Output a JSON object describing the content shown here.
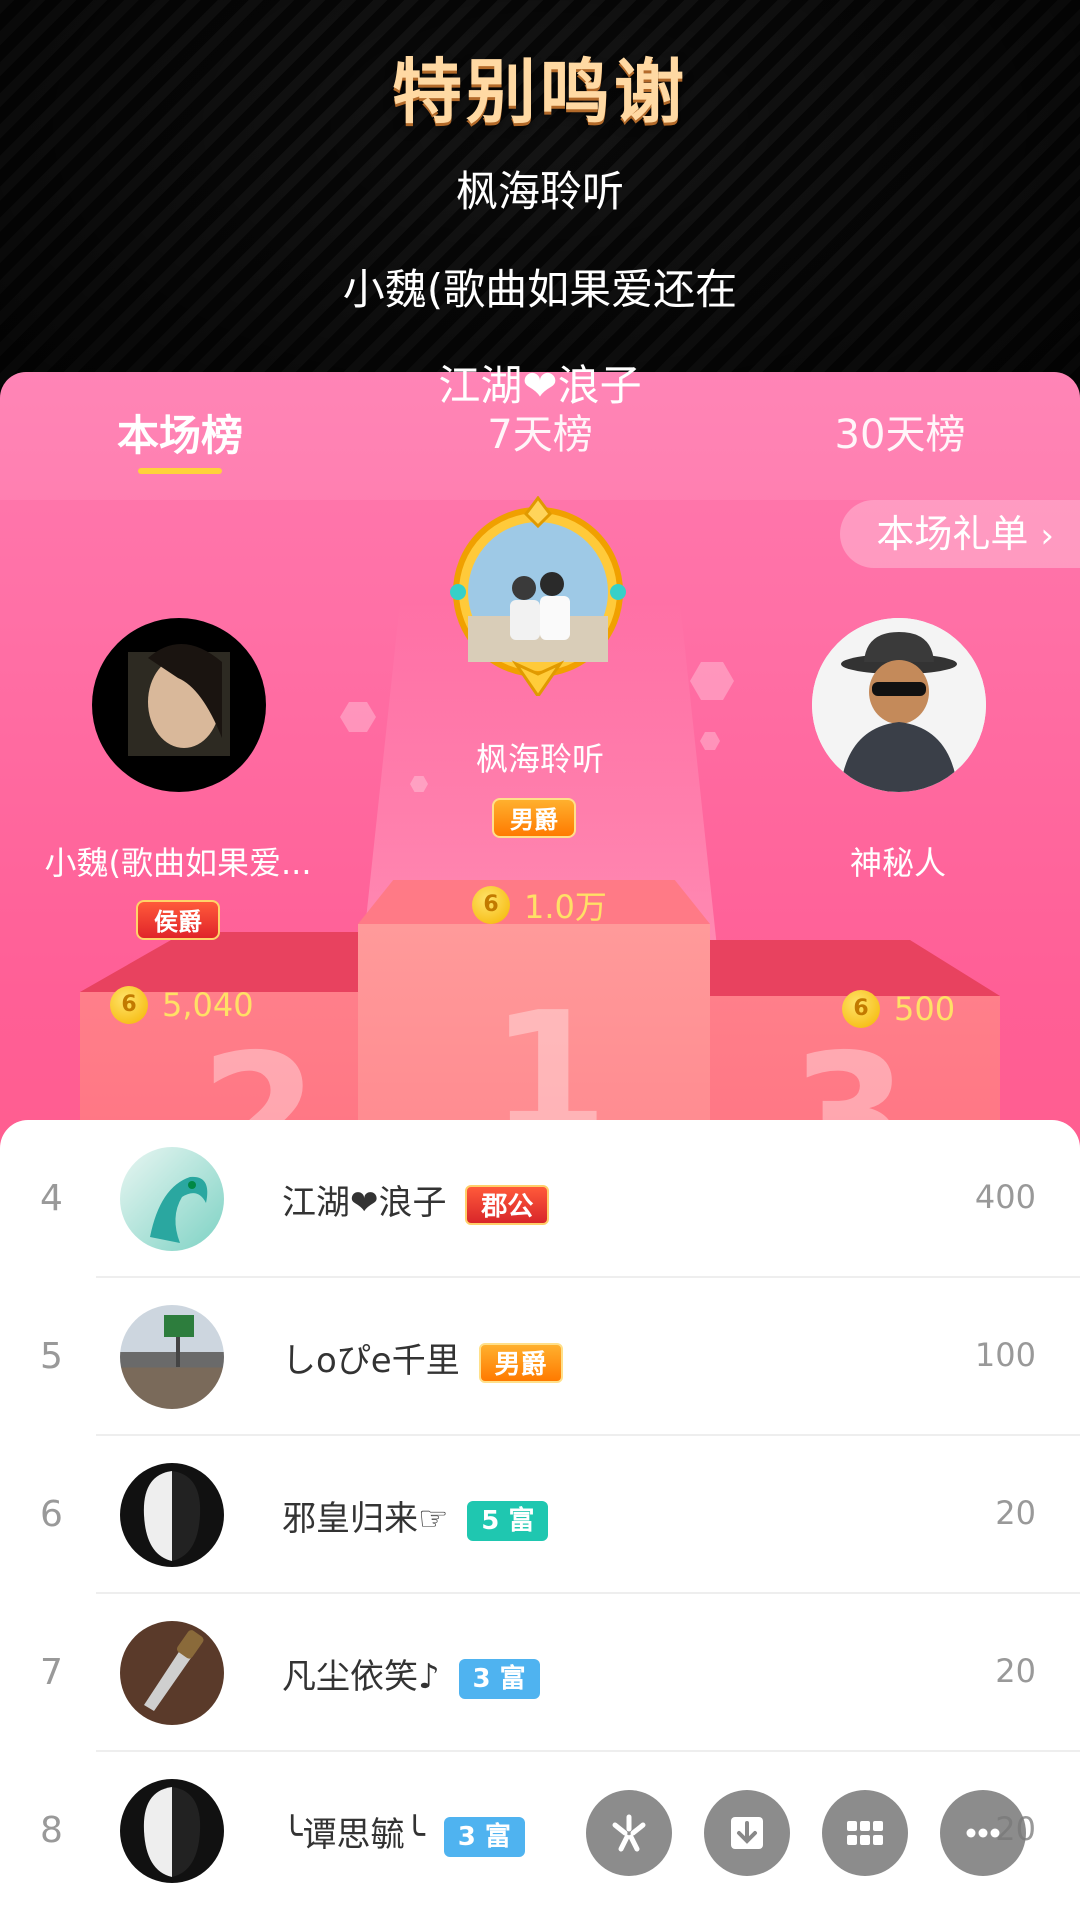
{
  "credits": {
    "title": "特别鸣谢",
    "lines": [
      "枫海聆听",
      "小魏(歌曲如果爱还在",
      "江湖❤浪子"
    ]
  },
  "tabs": [
    {
      "label": "本场榜",
      "active": true
    },
    {
      "label": "7天榜",
      "active": false
    },
    {
      "label": "30天榜",
      "active": false
    }
  ],
  "gift_list_link": "本场礼单",
  "top3": {
    "first": {
      "name": "枫海聆听",
      "badge": "男爵",
      "coins": "1.0万"
    },
    "second": {
      "name": "小魏(歌曲如果爱...",
      "badge": "侯爵",
      "coins": "5,040"
    },
    "third": {
      "name": "神秘人",
      "coins": "500"
    }
  },
  "podium_numbers": [
    "1",
    "2",
    "3"
  ],
  "ranking": [
    {
      "rank": "4",
      "name": "江湖❤浪子",
      "badge": "郡公",
      "score": "400"
    },
    {
      "rank": "5",
      "name": "しoぴe千里",
      "badge": "男爵",
      "score": "100"
    },
    {
      "rank": "6",
      "name": "邪皇归来☞",
      "badge": "5 富",
      "score": "20"
    },
    {
      "rank": "7",
      "name": "凡尘依笑♪",
      "badge": "3 富",
      "score": "20"
    },
    {
      "rank": "8",
      "name": "╰谭思毓╰",
      "badge": "3 富",
      "score": "20"
    }
  ],
  "coin_symbol": "6",
  "colors": {
    "accent": "#ffd23a",
    "panel": "#ff5f96",
    "level_teal": "#1fc7b0",
    "level_blue": "#4fb3f0"
  }
}
